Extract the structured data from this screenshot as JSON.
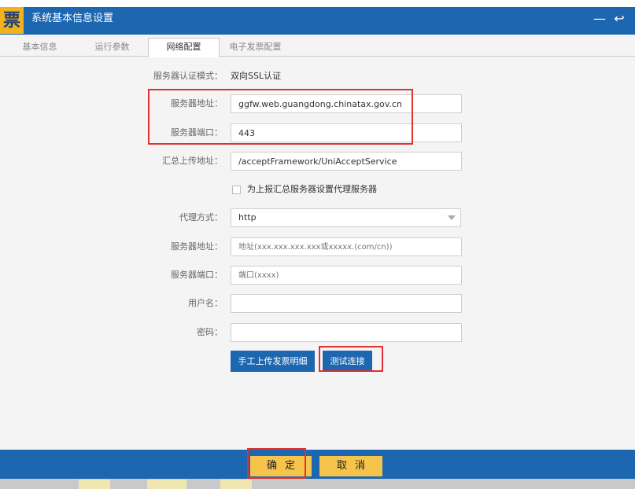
{
  "window": {
    "title": "系统基本信息设置",
    "logo_char": "票",
    "min_glyph": "—",
    "back_glyph": "↩"
  },
  "tabs": [
    {
      "label": "基本信息",
      "active": false
    },
    {
      "label": "运行参数",
      "active": false
    },
    {
      "label": "网络配置",
      "active": true
    },
    {
      "label": "电子发票配置",
      "active": false
    }
  ],
  "form": {
    "auth_mode": {
      "label": "服务器认证模式：",
      "value": "双向SSL认证"
    },
    "server_address": {
      "label": "服务器地址：",
      "value": "ggfw.web.guangdong.chinatax.gov.cn"
    },
    "server_port": {
      "label": "服务器端口：",
      "value": "443"
    },
    "upload_address": {
      "label": "汇总上传地址：",
      "value": "/acceptFramework/UniAcceptService"
    },
    "proxy_checkbox": {
      "label": "为上报汇总服务器设置代理服务器",
      "checked": false
    },
    "proxy_mode": {
      "label": "代理方式：",
      "value": "http"
    },
    "proxy_server_address": {
      "label": "服务器地址：",
      "placeholder": "地址(xxx.xxx.xxx.xxx或xxxxx.(com/cn))"
    },
    "proxy_server_port": {
      "label": "服务器端口：",
      "placeholder": "端口(xxxx)"
    },
    "username": {
      "label": "用户名：",
      "value": ""
    },
    "password": {
      "label": "密码：",
      "value": ""
    }
  },
  "buttons": {
    "manual_upload": "手工上传发票明细",
    "test_connection": "测试连接",
    "confirm": "确定",
    "cancel": "取消"
  },
  "colors": {
    "brand_blue": "#1d67b0",
    "accent_yellow": "#f6c34b",
    "highlight_red": "#e0302f"
  }
}
